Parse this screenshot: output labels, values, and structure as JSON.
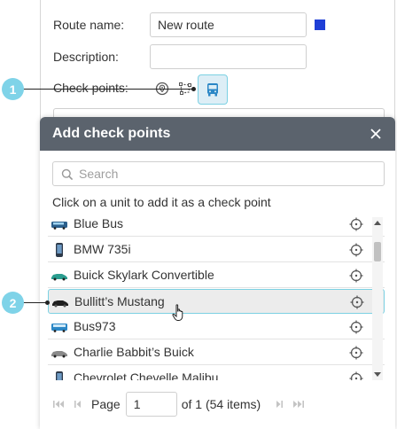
{
  "form": {
    "route_name_label": "Route name:",
    "route_name_value": "New route",
    "description_label": "Description:",
    "description_value": "",
    "check_points_label": "Check points:",
    "route_color": "#1f3fd6"
  },
  "dialog": {
    "title": "Add check points",
    "search_placeholder": "Search",
    "hint": "Click on a unit to add it as a check point",
    "units": [
      {
        "name": "Blue Bus",
        "icon": "bus-icon"
      },
      {
        "name": "BMW 735i",
        "icon": "phone-icon"
      },
      {
        "name": "Buick Skylark Convertible",
        "icon": "car-icon"
      },
      {
        "name": "Bullitt’s Mustang",
        "icon": "car-icon"
      },
      {
        "name": "Bus973",
        "icon": "bus-icon"
      },
      {
        "name": "Charlie Babbit’s Buick",
        "icon": "car-icon"
      },
      {
        "name": "Chevrolet Chevelle Malibu",
        "icon": "phone-icon"
      }
    ],
    "pager": {
      "page_label": "Page",
      "page_value": "1",
      "info": "of 1 (54 items)"
    }
  },
  "callouts": {
    "one": "1",
    "two": "2"
  }
}
